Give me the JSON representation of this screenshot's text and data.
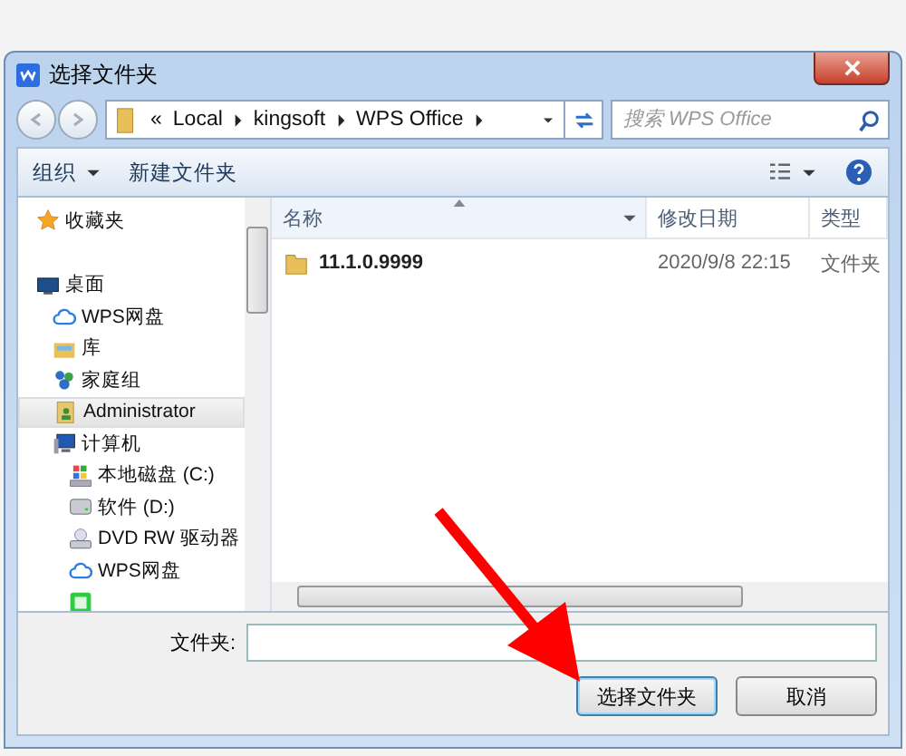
{
  "window": {
    "title": "选择文件夹"
  },
  "address": {
    "overflow": "«",
    "crumbs": [
      "Local",
      "kingsoft",
      "WPS Office"
    ]
  },
  "search": {
    "placeholder": "搜索 WPS Office"
  },
  "toolbar": {
    "organize": "组织",
    "new_folder": "新建文件夹"
  },
  "sidebar": {
    "groups": [
      {
        "items": [
          {
            "label": "收藏夹",
            "kind": "star",
            "selected": false
          }
        ]
      },
      {
        "items": [
          {
            "label": "桌面",
            "kind": "desktop",
            "selected": false,
            "children": [
              {
                "label": "WPS网盘",
                "kind": "cloud",
                "selected": false
              },
              {
                "label": "库",
                "kind": "library",
                "selected": false
              },
              {
                "label": "家庭组",
                "kind": "homegroup",
                "selected": false
              },
              {
                "label": "Administrator",
                "kind": "user",
                "selected": true
              },
              {
                "label": "计算机",
                "kind": "computer",
                "selected": false,
                "children": [
                  {
                    "label": "本地磁盘 (C:)",
                    "kind": "windrive",
                    "selected": false
                  },
                  {
                    "label": "软件 (D:)",
                    "kind": "drive",
                    "selected": false
                  },
                  {
                    "label": "DVD RW 驱动器",
                    "kind": "dvd",
                    "selected": false
                  },
                  {
                    "label": "WPS网盘",
                    "kind": "cloud",
                    "selected": false
                  },
                  {
                    "kind": "app",
                    "selected": false
                  }
                ]
              }
            ]
          }
        ]
      }
    ]
  },
  "table": {
    "columns": [
      {
        "label": "名称",
        "sorted": true
      },
      {
        "label": "修改日期",
        "sorted": false
      },
      {
        "label": "类型",
        "sorted": false
      }
    ],
    "rows": [
      {
        "name": "11.1.0.9999",
        "modified": "2020/9/8 22:15",
        "type": "文件夹"
      }
    ]
  },
  "folder_field": {
    "label": "文件夹:"
  },
  "buttons": [
    {
      "label": "选择文件夹",
      "default": true
    },
    {
      "label": "取消",
      "default": false
    }
  ]
}
